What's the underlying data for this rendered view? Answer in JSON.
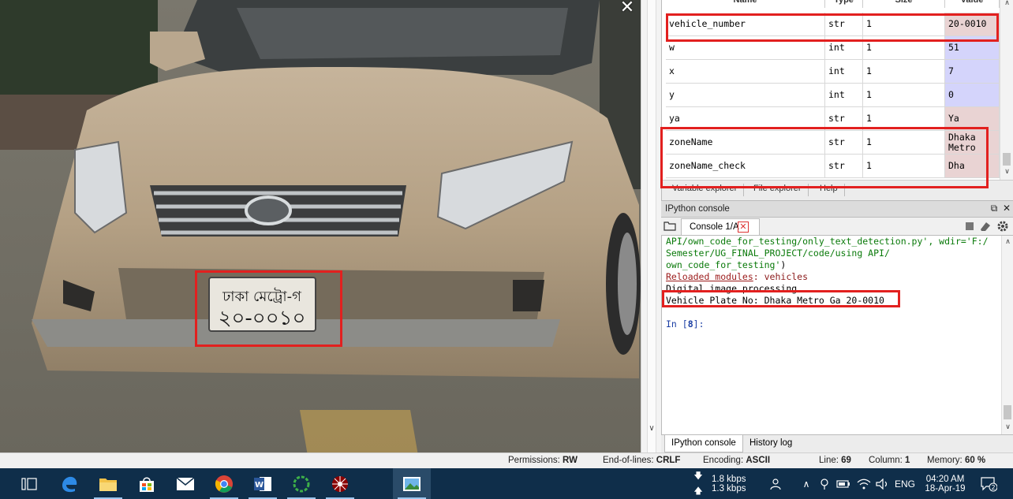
{
  "photo_viewer": {
    "close_glyph": "✕",
    "plate_line1": "ঢাকা মেট্রো-গ",
    "plate_line2": "২০-০০১০"
  },
  "variable_explorer": {
    "columns": [
      "Name",
      "Type",
      "Size",
      "Value"
    ],
    "rows": [
      {
        "name": "vehicle_number",
        "type": "str",
        "size": "1",
        "value": "20-0010",
        "color": "#e9d3d3"
      },
      {
        "name": "w",
        "type": "int",
        "size": "1",
        "value": "51",
        "color": "#d4d4fb"
      },
      {
        "name": "x",
        "type": "int",
        "size": "1",
        "value": "7",
        "color": "#d4d4fb"
      },
      {
        "name": "y",
        "type": "int",
        "size": "1",
        "value": "0",
        "color": "#d4d4fb"
      },
      {
        "name": "ya",
        "type": "str",
        "size": "1",
        "value": "Ya",
        "color": "#e9d3d3"
      },
      {
        "name": "zoneName",
        "type": "str",
        "size": "1",
        "value": "Dhaka\nMetro",
        "color": "#e9d3d3"
      },
      {
        "name": "zoneName_check",
        "type": "str",
        "size": "1",
        "value": "Dha",
        "color": "#e9d3d3"
      }
    ],
    "tabs": [
      "Variable explorer",
      "File explorer",
      "Help"
    ]
  },
  "ipython": {
    "pane_title": "IPython console",
    "console_tab": "Console 1/A",
    "lines": {
      "l1": "API/own_code_for_testing/only_text_detection.py', wdir='F:/",
      "l2": "Semester/UG_FINAL_PROJECT/code/using API/",
      "l3a": "own_code_for_testing'",
      "l3b": ")",
      "l4a": "Reloaded modules",
      "l4b": ": vehicles",
      "l5": "Digital image processing......",
      "l6": "Vehicle Plate No: Dhaka Metro Ga 20-0010",
      "l7a": "In [",
      "l7b": "8",
      "l7c": "]:"
    },
    "bottom_tabs": [
      "IPython console",
      "History log"
    ]
  },
  "statusbar": {
    "permissions_label": "Permissions:",
    "permissions_value": "RW",
    "eol_label": "End-of-lines:",
    "eol_value": "CRLF",
    "encoding_label": "Encoding:",
    "encoding_value": "ASCII",
    "line_label": "Line:",
    "line_value": "69",
    "column_label": "Column:",
    "column_value": "1",
    "memory_label": "Memory:",
    "memory_value": "60 %"
  },
  "taskbar": {
    "download_speed": "1.8 kbps",
    "upload_speed": "1.3 kbps",
    "language": "ENG",
    "time": "04:20 AM",
    "date": "18-Apr-19",
    "notification_count": "2"
  },
  "colors": {
    "highlight": "#e2201f",
    "taskbar": "#0f2e4a"
  }
}
